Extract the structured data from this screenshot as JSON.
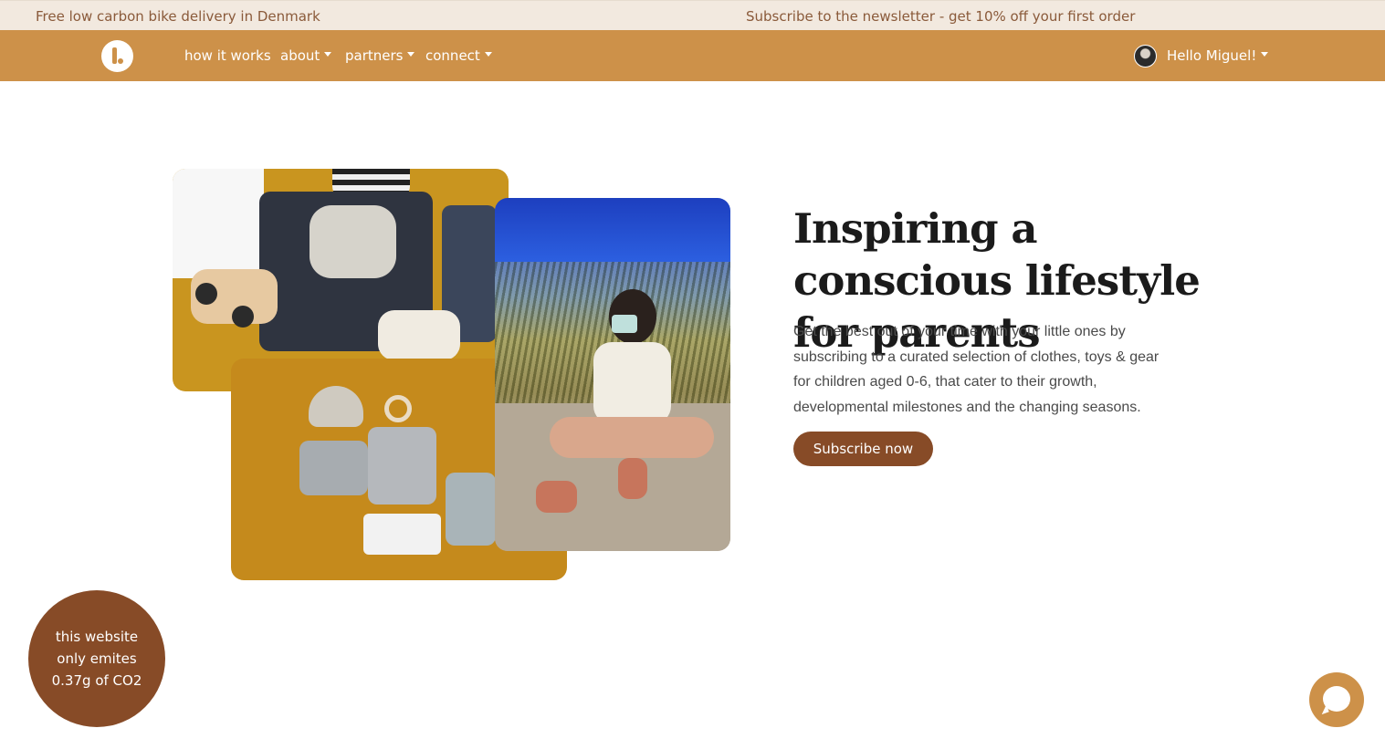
{
  "topbar": {
    "left_text": "Free low carbon bike delivery in Denmark",
    "right_text": "Subscribe to the newsletter - get 10% off your first order"
  },
  "nav": {
    "items": [
      {
        "label": "how it works",
        "has_dropdown": false
      },
      {
        "label": "about",
        "has_dropdown": true
      },
      {
        "label": "partners",
        "has_dropdown": true
      },
      {
        "label": "connect",
        "has_dropdown": true
      }
    ],
    "user_greeting": "Hello Miguel!"
  },
  "hero": {
    "title": "Inspiring a conscious lifestyle for parents",
    "text": "Get the best out of your time with your little ones by subscribing to a curated selection of clothes, toys & gear for children aged 0-6, that cater to their growth, developmental milestones and the changing seasons.",
    "cta_label": "Subscribe now"
  },
  "co2_badge": {
    "line1": "this website",
    "line2": "only emites",
    "line3": "0.37g of CO2"
  },
  "colors": {
    "nav_bg": "#cd9149",
    "topbar_bg": "#f2e9df",
    "accent_brown": "#874b27"
  },
  "icons": {
    "logo": "brand-logo-icon",
    "chat": "chat-bubble-icon",
    "dropdown": "caret-down-icon"
  }
}
